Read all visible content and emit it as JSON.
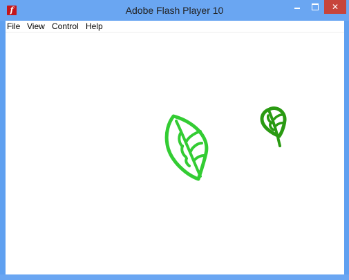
{
  "window": {
    "title": "Adobe Flash Player 10",
    "app_icon_glyph": "f",
    "close_glyph": "✕"
  },
  "menu": {
    "items": [
      {
        "label": "File"
      },
      {
        "label": "View"
      },
      {
        "label": "Control"
      },
      {
        "label": "Help"
      }
    ]
  },
  "stage": {
    "leaves": [
      {
        "name": "large-leaf",
        "color": "#33cc33"
      },
      {
        "name": "small-leaf",
        "color": "#2a9a12"
      }
    ]
  },
  "colors": {
    "titlebar": "#6aa6f2",
    "close_button": "#c7443b",
    "flash_icon": "#c4161c"
  }
}
